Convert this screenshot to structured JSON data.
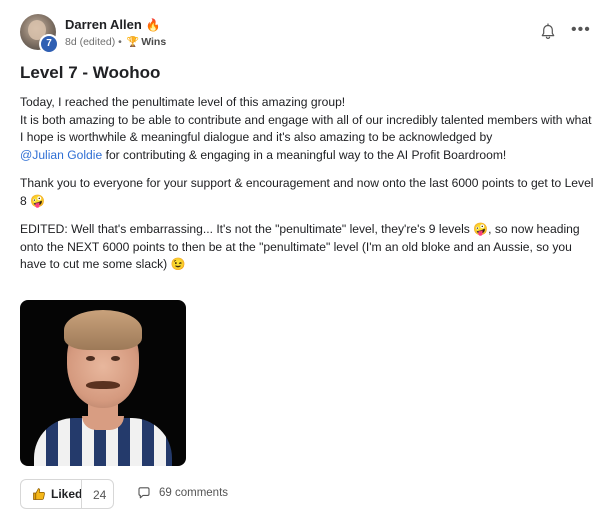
{
  "post": {
    "author": "Darren Allen",
    "author_emoji": "🔥",
    "level": "7",
    "meta_time": "8d (edited)",
    "meta_sep": "•",
    "category_icon": "trophy-icon",
    "category": "Wins",
    "title": "Level 7 - Woohoo",
    "paragraph1_line1": "Today, I reached the penultimate level of this amazing group!",
    "paragraph1_line2": "It is both amazing to be able to contribute and engage with all of our incredibly talented members with what I hope is worthwhile & meaningful dialogue and it's also amazing to be acknowledged by",
    "mention": "@Julian Goldie",
    "paragraph1_line2_end": "for contributing & engaging in a meaningful way to the AI Profit Boardroom!",
    "paragraph2": "Thank you to everyone for your support & encouragement and now onto the last 6000 points to get to Level 8",
    "paragraph2_emoji": "🤪",
    "paragraph3_a": "EDITED: Well that's embarrassing... It's not the \"penultimate\" level, they're's 9 levels",
    "paragraph3_emoji1": "🤪",
    "paragraph3_b": ", so now heading onto the NEXT 6000 points to then be at the \"penultimate\" level (I'm an old bloke and an Aussie, so you have to cut me some slack)",
    "paragraph3_emoji2": "😉",
    "liked_label": "Liked",
    "like_count": "24",
    "comments_label": "69 comments"
  },
  "icons": {
    "bell": "bell-icon",
    "more": "more-icon",
    "like": "thumbs-up-icon",
    "comment": "comment-icon"
  },
  "colors": {
    "mention": "#2f6fd4",
    "level_badge": "#2f5fb3"
  }
}
